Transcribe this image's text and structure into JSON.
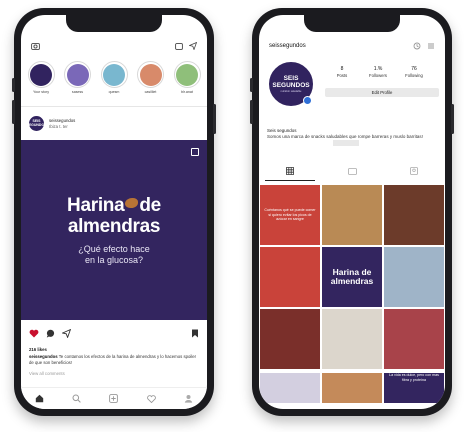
{
  "left_phone": {
    "stories": [
      {
        "label": "Your story",
        "color": "#31235f"
      },
      {
        "label": "sasess",
        "color": "#7a68b8"
      },
      {
        "label": "quesm",
        "color": "#79b7cf"
      },
      {
        "label": "casilliet",
        "color": "#d88a6a"
      },
      {
        "label": "blr.anat",
        "color": "#8fbf7a"
      }
    ],
    "post": {
      "account_name": "seissegundos",
      "account_location": "Ibiza t. ter",
      "logo_text": "SEIS SEGUNDOS",
      "title_line1_a": "Harina",
      "title_line1_b": "de",
      "title_line2": "almendras",
      "subtitle_line1": "¿Qué efecto hace",
      "subtitle_line2": "en la glucosa?",
      "likes": "216 likes",
      "caption_user": "seissegundos",
      "caption_text": "Te contamos los efectos de la harina de almendras y lo hacemos spoiler de que son beneficios!",
      "view_all": "View all comments",
      "bg_color": "#33255f",
      "like_color": "#c8102e"
    },
    "tabbar_icons": [
      "home-icon",
      "search-icon",
      "add-icon",
      "heart-icon",
      "profile-icon"
    ]
  },
  "right_phone": {
    "username": "seissegundos",
    "avatar_text": "SEIS SEGUNDOS",
    "avatar_subtext": "nutrición saludable",
    "stats": [
      {
        "value": "8",
        "label": "Posts"
      },
      {
        "value": "1.%",
        "label": "Followers"
      },
      {
        "value": "76",
        "label": "Following"
      }
    ],
    "edit_button": "Edit Profile",
    "bio_name": "Seis segundos",
    "bio_text": "Somos una marca de snacks saludables que rompe barreras y muslo barritas!",
    "grid": [
      {
        "bg": "#c9433a",
        "text": "Cuéntanos qué se puede comer si quiero evitar los picos de azúcar en sangre"
      },
      {
        "bg": "#b98a55",
        "text": ""
      },
      {
        "bg": "#6c3b2a",
        "text": ""
      },
      {
        "bg": "#c9433a",
        "text": ""
      },
      {
        "bg": "#33255f",
        "text": "Harina de almendras",
        "big": true
      },
      {
        "bg": "#9fb4c8",
        "text": ""
      },
      {
        "bg": "#7a2f2a",
        "text": ""
      },
      {
        "bg": "#dcd6cc",
        "text": ""
      },
      {
        "bg": "#a8434a",
        "text": ""
      }
    ],
    "bottom_row": [
      {
        "bg": "#d3cfe0",
        "text": ""
      },
      {
        "bg": "#c48a5a",
        "text": ""
      },
      {
        "bg": "#33255f",
        "text": "La vida es dulce, pero con mas fibra y proteína"
      }
    ]
  }
}
